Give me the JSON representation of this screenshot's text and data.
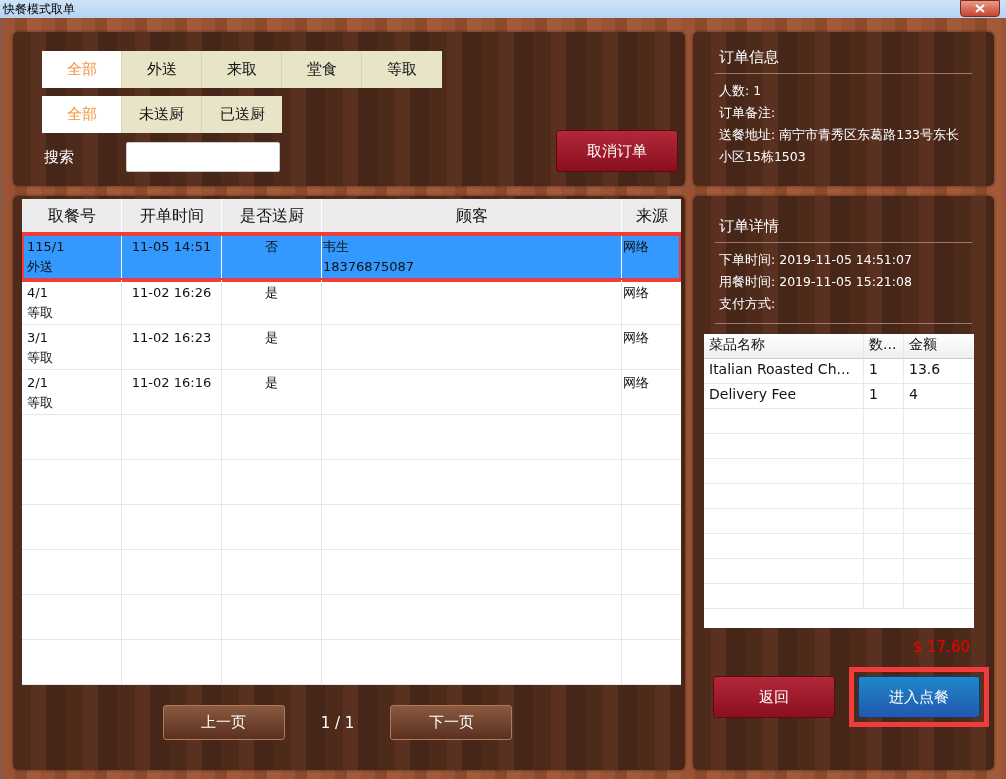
{
  "window": {
    "title": "快餐模式取单"
  },
  "type_tabs": [
    {
      "label": "全部",
      "selected": true
    },
    {
      "label": "外送",
      "selected": false
    },
    {
      "label": "来取",
      "selected": false
    },
    {
      "label": "堂食",
      "selected": false
    },
    {
      "label": "等取",
      "selected": false
    }
  ],
  "kitchen_tabs": [
    {
      "label": "全部",
      "selected": true
    },
    {
      "label": "未送厨",
      "selected": false
    },
    {
      "label": "已送厨",
      "selected": false
    }
  ],
  "search": {
    "label": "搜索"
  },
  "cancel_button": "取消订单",
  "orders": {
    "columns": [
      "取餐号",
      "开单时间",
      "是否送厨",
      "顾客",
      "来源"
    ],
    "rows": [
      {
        "pickup_no": "115/1",
        "order_type": "外送",
        "opened": "11-05 14:51",
        "sent_to_kitchen": "否",
        "customer_name": "韦生",
        "customer_phone": "18376875087",
        "source": "网络",
        "selected": true,
        "highlighted": true
      },
      {
        "pickup_no": "4/1",
        "order_type": "等取",
        "opened": "11-02 16:26",
        "sent_to_kitchen": "是",
        "source": "网络",
        "selected": false,
        "highlighted": false
      },
      {
        "pickup_no": "3/1",
        "order_type": "等取",
        "opened": "11-02 16:23",
        "sent_to_kitchen": "是",
        "source": "网络",
        "selected": false,
        "highlighted": false
      },
      {
        "pickup_no": "2/1",
        "order_type": "等取",
        "opened": "11-02 16:16",
        "sent_to_kitchen": "是",
        "source": "网络",
        "selected": false,
        "highlighted": false
      }
    ]
  },
  "pager": {
    "prev": "上一页",
    "page": "1 / 1",
    "next": "下一页"
  },
  "order_info": {
    "title": "订单信息",
    "lines": [
      "人数: 1",
      "订单备注:",
      "送餐地址: 南宁市青秀区东葛路133号东长小区15栋1503"
    ]
  },
  "order_detail": {
    "title": "订单详情",
    "lines": [
      "下单时间: 2019-11-05 14:51:07",
      "用餐时间: 2019-11-05 15:21:08",
      "支付方式:"
    ],
    "columns": [
      "菜品名称",
      "数...",
      "金额"
    ],
    "rows": [
      {
        "name": "Italian Roasted Ch...",
        "qty": "1",
        "amount": "13.6"
      },
      {
        "name": "Delivery Fee",
        "qty": "1",
        "amount": "4"
      }
    ],
    "total": "$ 17.60"
  },
  "buttons": [
    {
      "label": "返回",
      "kind": "back",
      "highlighted": false
    },
    {
      "label": "进入点餐",
      "kind": "enter",
      "highlighted": true
    }
  ]
}
